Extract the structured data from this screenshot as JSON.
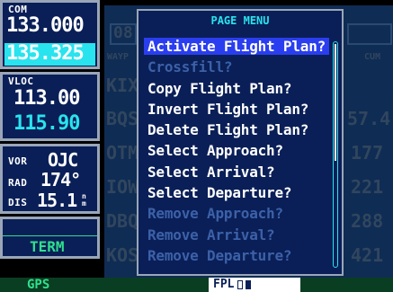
{
  "com": {
    "label": "COM",
    "active": "133.000",
    "standby": "135.325"
  },
  "vloc": {
    "label": "VLOC",
    "active": "113.00",
    "standby": "115.90"
  },
  "vor": {
    "label": "VOR",
    "ident": "OJC",
    "rad_label": "RAD",
    "rad_value": "174°",
    "dis_label": "DIS",
    "dis_value": "15.1",
    "dis_unit": "n m"
  },
  "mode": {
    "label": "TERM"
  },
  "menu": {
    "title": "PAGE MENU",
    "items": [
      {
        "label": "Activate Flight Plan?",
        "state": "selected"
      },
      {
        "label": "Crossfill?",
        "state": "disabled"
      },
      {
        "label": "Copy Flight Plan?",
        "state": "enabled"
      },
      {
        "label": "Invert Flight Plan?",
        "state": "enabled"
      },
      {
        "label": "Delete Flight Plan?",
        "state": "enabled"
      },
      {
        "label": "Select Approach?",
        "state": "enabled"
      },
      {
        "label": "Select Arrival?",
        "state": "enabled"
      },
      {
        "label": "Select Departure?",
        "state": "enabled"
      },
      {
        "label": "Remove Approach?",
        "state": "disabled"
      },
      {
        "label": "Remove Arrival?",
        "state": "disabled"
      },
      {
        "label": "Remove Departure?",
        "state": "disabled"
      }
    ]
  },
  "background": {
    "fp_number": "08",
    "col1": "WAYP",
    "col3": "CUM",
    "rows": [
      {
        "wpt": "KIX",
        "val": ""
      },
      {
        "wpt": "BQS",
        "val": "57.4"
      },
      {
        "wpt": "OTM",
        "val": "177"
      },
      {
        "wpt": "IOW",
        "val": "221"
      },
      {
        "wpt": "DBQ",
        "val": "288"
      },
      {
        "wpt": "KOS",
        "val": "421"
      }
    ]
  },
  "status": {
    "gps_label": "GPS",
    "fpl_label": "FPL"
  }
}
